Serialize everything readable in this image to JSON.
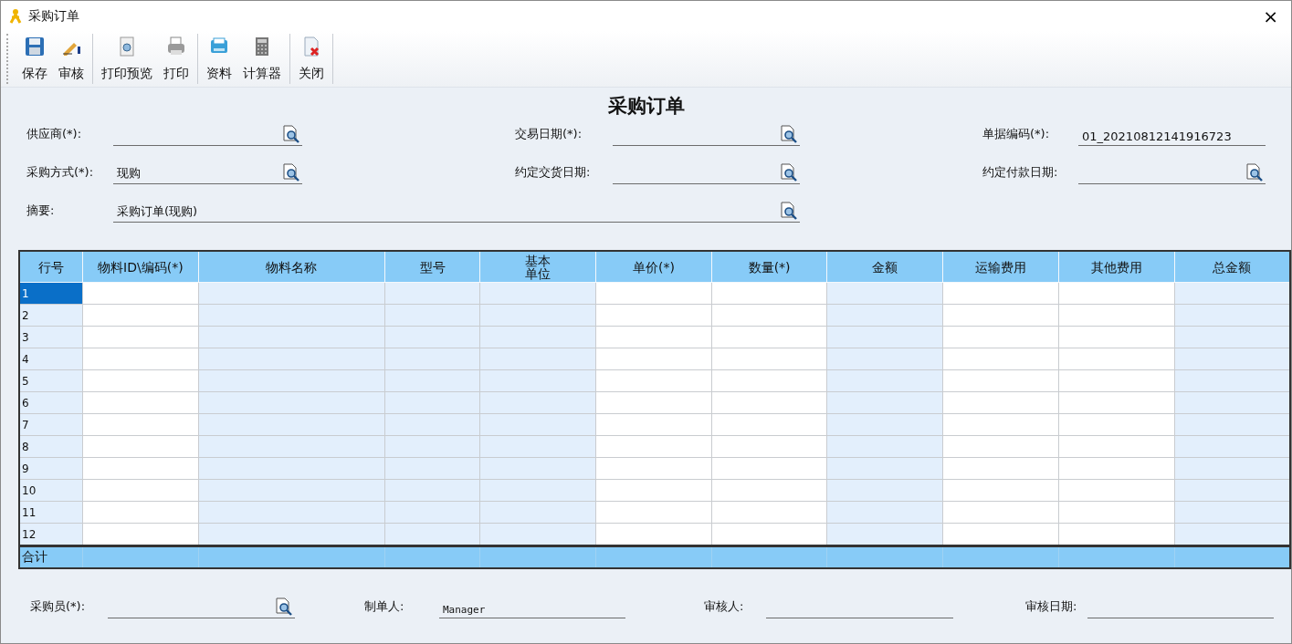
{
  "window": {
    "title": "采购订单",
    "close": "×"
  },
  "toolbar": {
    "groups": [
      [
        {
          "label": "保存"
        },
        {
          "label": "审核"
        }
      ],
      [
        {
          "label": "打印预览"
        },
        {
          "label": "打印"
        }
      ],
      [
        {
          "label": "资料"
        },
        {
          "label": "计算器"
        }
      ],
      [
        {
          "label": "关闭"
        }
      ]
    ]
  },
  "form": {
    "title": "采购订单",
    "fields": [
      {
        "label": "供应商(*):",
        "lookup": true
      },
      {
        "label": "交易日期(*):",
        "lookup": true
      },
      {
        "label": "单据编码(*):",
        "value": "01_20210812141916723",
        "lookup": false
      },
      {
        "label": "采购方式(*):",
        "value": "现购",
        "lookup": true
      },
      {
        "label": "约定交货日期:",
        "lookup": true
      },
      {
        "label": "约定付款日期:",
        "lookup": true
      }
    ],
    "summary": {
      "label": "摘要:",
      "value": "采购订单(现购)",
      "lookup": true
    }
  },
  "table": {
    "columns": [
      {
        "label": "行号",
        "readonly": true
      },
      {
        "label": "物料ID\\编码(*)",
        "readonly": false
      },
      {
        "label": "物料名称",
        "readonly": true
      },
      {
        "label": "型号",
        "readonly": true
      },
      {
        "label": "基本单位",
        "readonly": true
      },
      {
        "label": "单价(*)",
        "readonly": false
      },
      {
        "label": "数量(*)",
        "readonly": false
      },
      {
        "label": "金额",
        "readonly": true
      },
      {
        "label": "运输费用",
        "readonly": false
      },
      {
        "label": "其他费用",
        "readonly": false
      },
      {
        "label": "总金额",
        "readonly": true
      }
    ],
    "rows": [
      {
        "row_number": "1",
        "selected": true
      },
      {
        "row_number": "2",
        "selected": false
      },
      {
        "row_number": "3",
        "selected": false
      },
      {
        "row_number": "4",
        "selected": false
      },
      {
        "row_number": "5",
        "selected": false
      },
      {
        "row_number": "6",
        "selected": false
      },
      {
        "row_number": "7",
        "selected": false
      },
      {
        "row_number": "8",
        "selected": false
      },
      {
        "row_number": "9",
        "selected": false
      },
      {
        "row_number": "10",
        "selected": false
      },
      {
        "row_number": "11",
        "selected": false
      },
      {
        "row_number": "12",
        "selected": false
      }
    ],
    "total_label": "合计"
  },
  "footer": [
    {
      "label": "采购员(*):",
      "lookup": true
    },
    {
      "label": "制单人:",
      "value": "Manager",
      "lookup": false
    },
    {
      "label": "审核人:",
      "lookup": false
    },
    {
      "label": "审核日期:",
      "lookup": false
    }
  ]
}
